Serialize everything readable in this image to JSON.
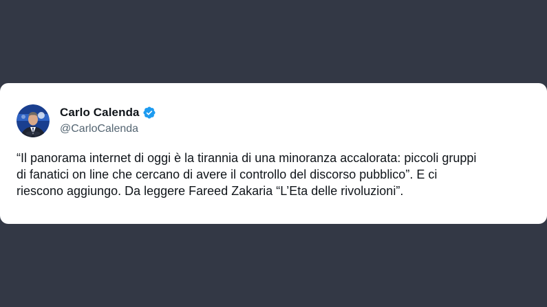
{
  "tweet": {
    "author": {
      "display_name": "Carlo Calenda",
      "handle": "@CarloCalenda",
      "verified": true,
      "avatar_icon": "profile-photo-avatar"
    },
    "text_lines": [
      "“Il panorama internet di oggi è la tirannia di una minoranza accalorata: piccoli gruppi",
      "di fanatici on line che cercano di avere il controllo del discorso pubblico”. E ci",
      "riescono aggiungo. Da leggere Fareed Zakaria “L’Eta delle rivoluzioni”."
    ]
  },
  "colors": {
    "background": "#333845",
    "card": "#ffffff",
    "text_primary": "#0f1419",
    "text_secondary": "#536471",
    "verified_badge": "#1d9bf0"
  }
}
